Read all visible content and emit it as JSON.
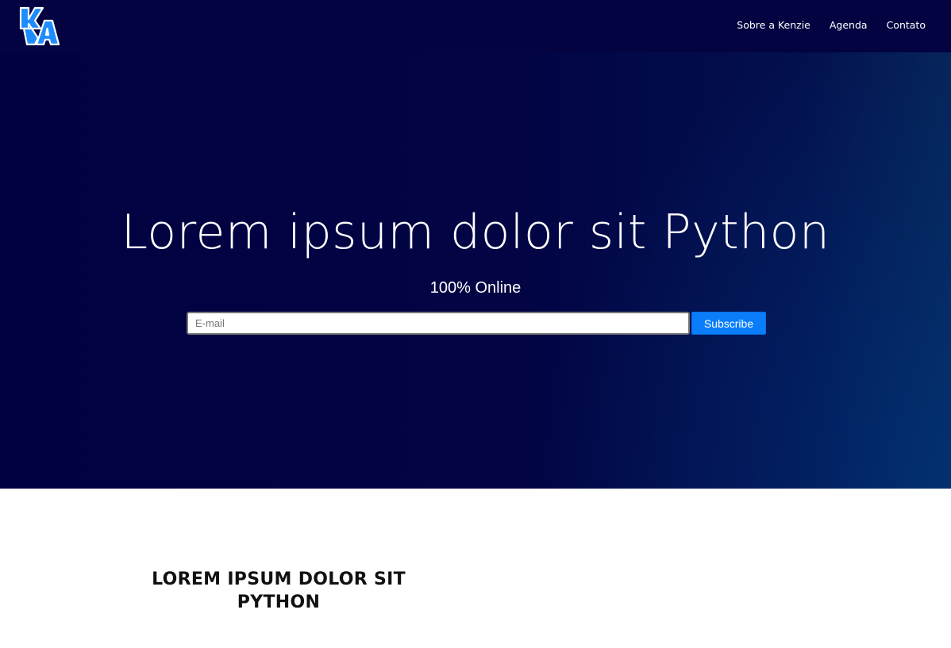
{
  "brand": {
    "logo_icon": "kenzie-academy-logo-icon",
    "accent_color": "#0a7dfa"
  },
  "nav": {
    "items": [
      {
        "label": "Sobre a Kenzie"
      },
      {
        "label": "Agenda"
      },
      {
        "label": "Contato"
      }
    ]
  },
  "hero": {
    "title": "Lorem ipsum dolor sit Python",
    "subtitle": "100% Online",
    "email_placeholder": "E-mail",
    "email_value": "",
    "subscribe_label": "Subscribe"
  },
  "section": {
    "heading": "LOREM IPSUM DOLOR SIT PYTHON"
  }
}
